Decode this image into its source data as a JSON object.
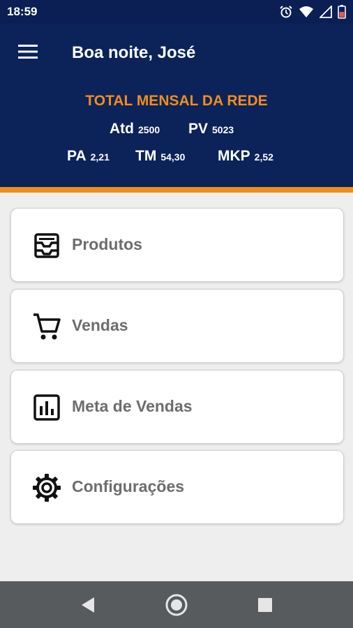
{
  "status_bar": {
    "time": "18:59",
    "icons": [
      "alarm-icon",
      "wifi-icon",
      "signal-icon",
      "battery-icon"
    ]
  },
  "header": {
    "greeting": "Boa noite, José",
    "summary_title": "TOTAL MENSAL DA REDE",
    "metrics": [
      {
        "label": "Atd",
        "value": "2500"
      },
      {
        "label": "PV",
        "value": "5023"
      },
      {
        "label": "PA",
        "value": "2,21"
      },
      {
        "label": "TM",
        "value": "54,30"
      },
      {
        "label": "MKP",
        "value": "2,52"
      }
    ],
    "colors": {
      "background": "#0b2359",
      "accent": "#f28c1c"
    }
  },
  "menu": {
    "items": [
      {
        "label": "Produtos",
        "icon": "inbox-tray-icon"
      },
      {
        "label": "Vendas",
        "icon": "shopping-cart-icon"
      },
      {
        "label": "Meta de Vendas",
        "icon": "bar-chart-icon"
      },
      {
        "label": "Configurações",
        "icon": "gear-icon"
      }
    ]
  },
  "nav_bar": {
    "buttons": [
      "back-icon",
      "home-icon",
      "recents-icon"
    ]
  }
}
